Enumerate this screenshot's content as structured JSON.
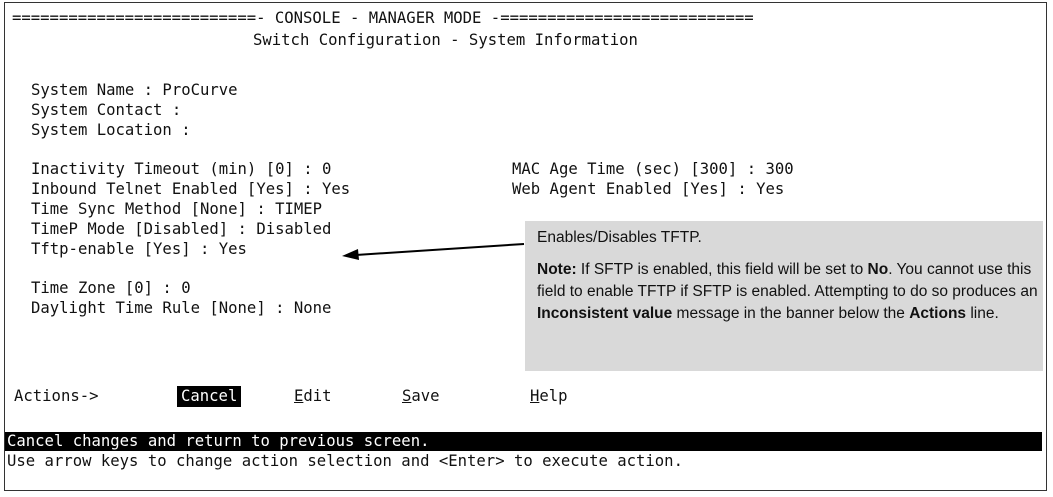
{
  "header": {
    "banner": "==========================- CONSOLE - MANAGER MODE -===========================",
    "subtitle": "Switch Configuration - System Information"
  },
  "system": {
    "name": "System Name : ProCurve",
    "contact": "System Contact :",
    "location": "System Location :"
  },
  "fields": {
    "inactivity_timeout": "Inactivity Timeout (min) [0] : 0",
    "inbound_telnet": "Inbound Telnet Enabled [Yes] : Yes",
    "time_sync": "Time Sync Method [None] : TIMEP",
    "timep_mode": "TimeP Mode [Disabled] : Disabled",
    "tftp_enable": "Tftp-enable [Yes] : Yes",
    "mac_age": "MAC Age Time (sec) [300] : 300",
    "web_agent": "Web Agent Enabled [Yes] : Yes",
    "time_zone": "Time Zone [0] : 0",
    "daylight_rule": "Daylight Time Rule [None] : None"
  },
  "callout": {
    "heading": "Enables/Disables TFTP.",
    "note_label": "Note:",
    "note_part1": " If SFTP is enabled, this field will be set to ",
    "note_no": "No",
    "note_part2": ". You cannot use this field to enable TFTP if SFTP is enabled. Attempting to do so produces an ",
    "note_inconsistent": "Inconsistent value",
    "note_part3": " message in the banner below the ",
    "note_actions": "Actions",
    "note_part4": " line."
  },
  "actions": {
    "label": "Actions->",
    "cancel": "Cancel",
    "edit_hot": "E",
    "edit_rest": "dit",
    "save_hot": "S",
    "save_rest": "ave",
    "help_hot": "H",
    "help_rest": "elp"
  },
  "status": {
    "line1": "Cancel changes and return to previous screen.",
    "line2": "Use arrow keys to change action selection and <Enter> to execute action."
  }
}
